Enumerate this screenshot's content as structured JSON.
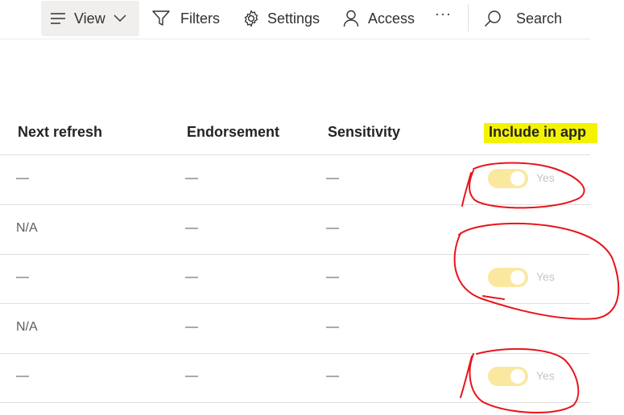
{
  "toolbar": {
    "view_label": "View",
    "filters_label": "Filters",
    "settings_label": "Settings",
    "access_label": "Access",
    "more_label": "···",
    "search_label": "Search"
  },
  "table": {
    "columns": [
      "Next refresh",
      "Endorsement",
      "Sensitivity",
      "Include in app"
    ],
    "rows": [
      {
        "next_refresh": "—",
        "endorsement": "—",
        "sensitivity": "—",
        "include": "Yes"
      },
      {
        "next_refresh": "N/A",
        "endorsement": "—",
        "sensitivity": "—",
        "include": ""
      },
      {
        "next_refresh": "—",
        "endorsement": "—",
        "sensitivity": "—",
        "include": "Yes"
      },
      {
        "next_refresh": "N/A",
        "endorsement": "—",
        "sensitivity": "—",
        "include": ""
      },
      {
        "next_refresh": "—",
        "endorsement": "—",
        "sensitivity": "—",
        "include": "Yes"
      }
    ]
  },
  "colors": {
    "highlight": "#f3f300",
    "toggle_disabled": "#fae8a0",
    "annotation": "#e8141b"
  },
  "icons": [
    "menu-lines-icon",
    "chevron-down-icon",
    "filter-icon",
    "gear-icon",
    "person-icon",
    "more-icon",
    "search-icon"
  ]
}
